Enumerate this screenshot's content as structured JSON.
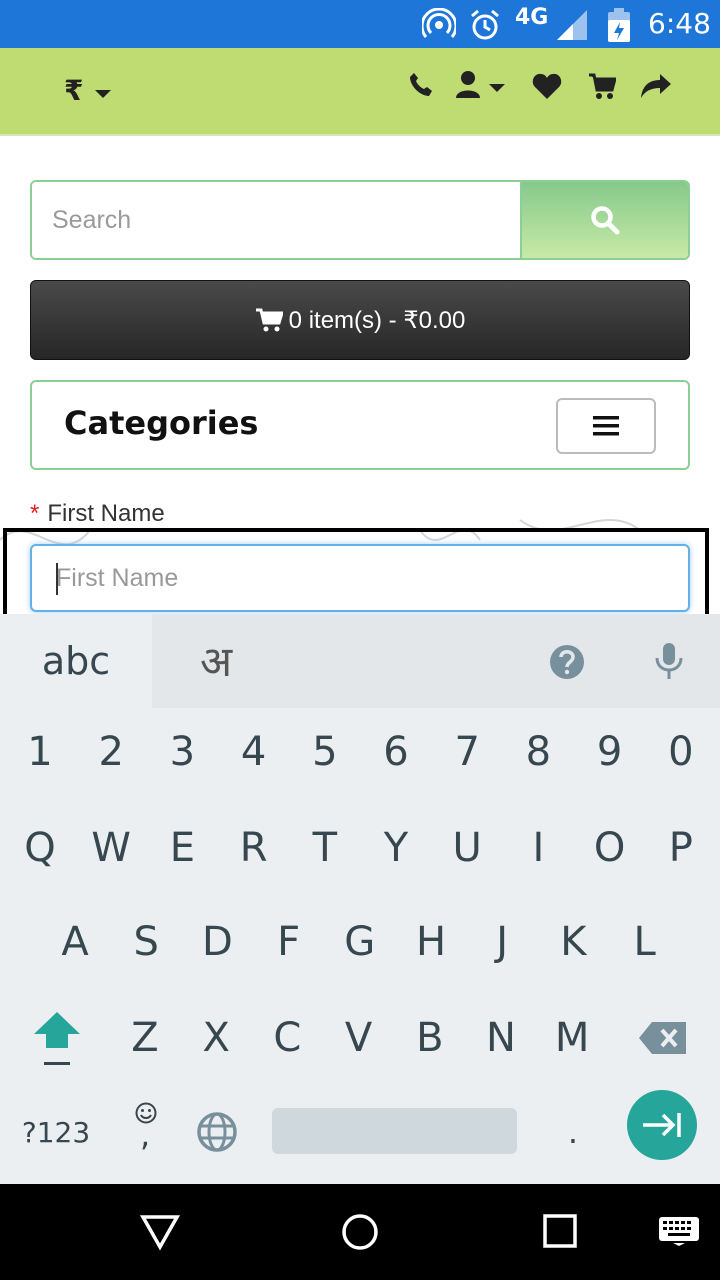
{
  "status_bar": {
    "network": "4G",
    "time": "6:48"
  },
  "header": {
    "currency": "₹"
  },
  "search": {
    "placeholder": "Search"
  },
  "cart": {
    "label": "0 item(s) - ₹0.00"
  },
  "categories": {
    "title": "Categories"
  },
  "form": {
    "first_name_label": "First Name",
    "required_mark": "*",
    "first_name_placeholder": "First Name",
    "first_name_value": ""
  },
  "keyboard": {
    "mode_abc": "abc",
    "mode_hindi": "अ",
    "row_numbers": [
      "1",
      "2",
      "3",
      "4",
      "5",
      "6",
      "7",
      "8",
      "9",
      "0"
    ],
    "row_q": [
      "Q",
      "W",
      "E",
      "R",
      "T",
      "Y",
      "U",
      "I",
      "O",
      "P"
    ],
    "row_a": [
      "A",
      "S",
      "D",
      "F",
      "G",
      "H",
      "J",
      "K",
      "L"
    ],
    "row_z": [
      "Z",
      "X",
      "C",
      "V",
      "B",
      "N",
      "M"
    ],
    "symbols_label": "?123",
    "comma": ",",
    "period": "."
  },
  "colors": {
    "header_bg": "#bfdc72",
    "status_bg": "#1e77d8",
    "accent_green": "#8ccf93",
    "enter_key": "#26a69a"
  }
}
